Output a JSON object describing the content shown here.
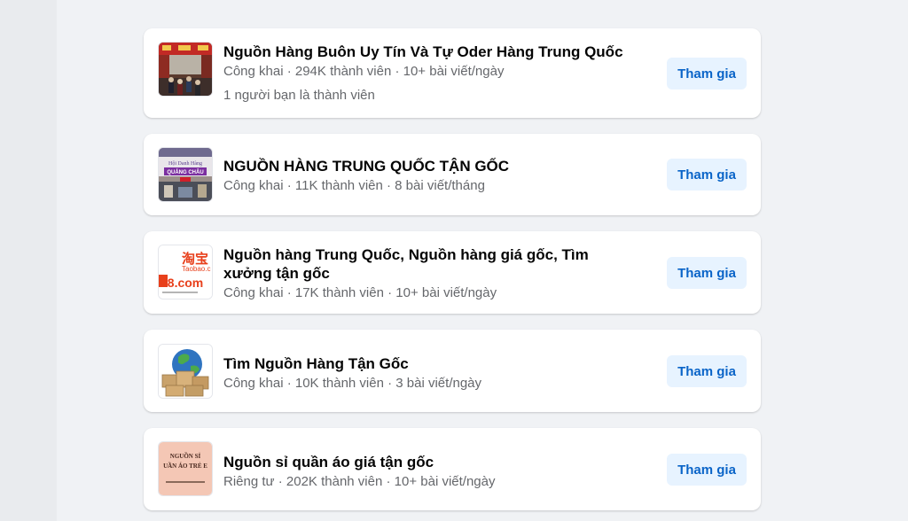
{
  "groups": [
    {
      "name": "Nguồn Hàng Buôn Uy Tín Và Tự Oder Hàng Trung Quốc",
      "meta": "Công khai · 294K thành viên · 10+ bài viết/ngày",
      "friends": "1 người bạn là thành viên",
      "join_label": "Tham gia",
      "thumb_icon": "chinese-street-market-photo"
    },
    {
      "name": "NGUỒN HÀNG TRUNG QUỐC TẬN GỐC",
      "meta": "Công khai · 11K thành viên · 8 bài viết/tháng",
      "join_label": "Tham gia",
      "thumb_icon": "wholesale-market-banner-photo",
      "thumb_text_1": "Hội Danh Hàng",
      "thumb_text_2": "QUẢNG CHÂU"
    },
    {
      "name": "Nguồn hàng Trung Quốc, Nguồn hàng giá gốc, Tìm xưởng tận gốc",
      "meta": "Công khai · 17K thành viên · 10+ bài viết/ngày",
      "join_label": "Tham gia",
      "thumb_icon": "taobao-1688-logo",
      "thumb_text_1": "淘宝",
      "thumb_text_2": "Taobao.c",
      "thumb_text_3": "88.com"
    },
    {
      "name": "Tìm Nguồn Hàng Tận Gốc",
      "meta": "Công khai · 10K thành viên · 3 bài viết/ngày",
      "join_label": "Tham gia",
      "thumb_icon": "globe-with-boxes-image"
    },
    {
      "name": "Nguồn sỉ quần áo giá tận gốc",
      "meta": "Riêng tư · 202K thành viên · 10+ bài viết/ngày",
      "join_label": "Tham gia",
      "thumb_icon": "clothing-wholesale-banner",
      "thumb_text_1": "NGUỒN SỈ",
      "thumb_text_2": "UẦN ÁO TRẺ E"
    }
  ],
  "colors": {
    "page_background": "#f0f2f5",
    "card_background": "#ffffff",
    "join_button_background": "#e7f3ff",
    "join_button_text": "#0a64c8",
    "primary_text": "#050505",
    "secondary_text": "#65676b"
  }
}
